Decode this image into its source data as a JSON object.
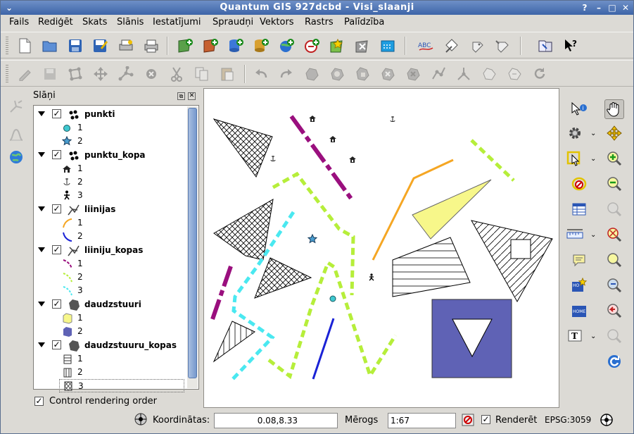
{
  "window": {
    "title": "Quantum GIS 927dcbd - Visi_slaanji"
  },
  "menu": [
    "Fails",
    "Rediģēt",
    "Skats",
    "Slānis",
    "Iestatījumi",
    "Spraudņi",
    "Vektors",
    "Rastrs",
    "Palīdzība"
  ],
  "layers_panel": {
    "title": "Slāņi"
  },
  "groups": [
    {
      "name": "punkti",
      "items": [
        "1",
        "2"
      ]
    },
    {
      "name": "punktu_kopa",
      "items": [
        "1",
        "2",
        "3"
      ]
    },
    {
      "name": "liinijas",
      "items": [
        "1",
        "2"
      ]
    },
    {
      "name": "liiniju_kopas",
      "items": [
        "1",
        "2",
        "3"
      ]
    },
    {
      "name": "daudzstuuri",
      "items": [
        "1",
        "2"
      ]
    },
    {
      "name": "daudzstuuru_kopas",
      "items": [
        "1",
        "2",
        "3"
      ]
    }
  ],
  "control_rendering_order": "Control rendering order",
  "status": {
    "coord_label": "Koordinātas:",
    "coord_value": "0.08,8.33",
    "scale_label": "Mērogs",
    "scale_value": "1:67",
    "render_label": "Renderēt",
    "crs": "EPSG:3059"
  },
  "colors": {
    "title_bar": "#3d65a8",
    "polygon_fill": "#5f62b5",
    "yellow_fill": "#f7f78a",
    "magenta": "#9a0f7e",
    "lime": "#b6ee3a",
    "cyan": "#4ae8f0",
    "orange": "#f5a623",
    "blue": "#1a22d6"
  },
  "icons": {
    "map_tools": [
      "pan-icon",
      "zoom-in-icon",
      "zoom-out-icon",
      "identify-icon"
    ]
  }
}
